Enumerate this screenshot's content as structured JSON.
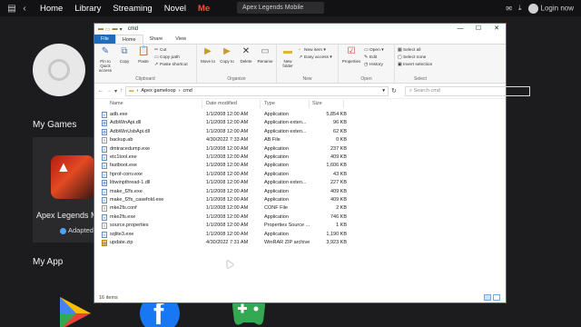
{
  "emulator": {
    "nav": [
      "Home",
      "Library",
      "Streaming",
      "Novel",
      "Me"
    ],
    "active_nav": "Me",
    "search_text": "Apex Legends Mobile",
    "login_label": "Login now",
    "accent": "#ff4b3e"
  },
  "page": {
    "my_games_title": "My Games",
    "game_name": "Apex Legends M",
    "game_badge": "Adapted",
    "my_app_title": "My App"
  },
  "explorer": {
    "title": "cmd",
    "controls": [
      "—",
      "☐",
      "✕"
    ],
    "tabs": [
      "File",
      "Home",
      "Share",
      "View"
    ],
    "ribbon": {
      "clipboard": {
        "pin": "Pin to Quick access",
        "copy": "Copy",
        "paste": "Paste",
        "cut": "Cut",
        "copy_path": "Copy path",
        "paste_shortcut": "Paste shortcut",
        "label": "Clipboard"
      },
      "organize": {
        "move_to": "Move to",
        "copy_to": "Copy to",
        "delete": "Delete",
        "rename": "Rename",
        "label": "Organize"
      },
      "new": {
        "new_folder": "New folder",
        "new_item": "New item",
        "easy_access": "Easy access",
        "label": "New"
      },
      "open": {
        "properties": "Properties",
        "open": "Open",
        "edit": "Edit",
        "history": "History",
        "label": "Open"
      },
      "select": {
        "select_all": "Select all",
        "select_none": "Select none",
        "invert": "Invert selection",
        "label": "Select"
      }
    },
    "breadcrumb": [
      "Apex gameloop",
      "cmd"
    ],
    "search_placeholder": "Search cmd",
    "columns": [
      "Name",
      "Date modified",
      "Type",
      "Size"
    ],
    "files": [
      {
        "name": "adb.exe",
        "date": "1/1/2008 12:00 AM",
        "type": "Application",
        "size": "5,854 KB",
        "icon": "exe"
      },
      {
        "name": "AdbWinApi.dll",
        "date": "1/1/2008 12:00 AM",
        "type": "Application exten...",
        "size": "96 KB",
        "icon": "dll"
      },
      {
        "name": "AdbWinUsbApi.dll",
        "date": "1/1/2008 12:00 AM",
        "type": "Application exten...",
        "size": "62 KB",
        "icon": "dll"
      },
      {
        "name": "backup.ab",
        "date": "4/30/2022 7:33 AM",
        "type": "AB File",
        "size": "0 KB",
        "icon": "text"
      },
      {
        "name": "dmtracedump.exe",
        "date": "1/1/2008 12:00 AM",
        "type": "Application",
        "size": "237 KB",
        "icon": "exe"
      },
      {
        "name": "etc1tool.exe",
        "date": "1/1/2008 12:00 AM",
        "type": "Application",
        "size": "409 KB",
        "icon": "exe"
      },
      {
        "name": "fastboot.exe",
        "date": "1/1/2008 12:00 AM",
        "type": "Application",
        "size": "1,606 KB",
        "icon": "exe"
      },
      {
        "name": "hprof-conv.exe",
        "date": "1/1/2008 12:00 AM",
        "type": "Application",
        "size": "43 KB",
        "icon": "exe"
      },
      {
        "name": "libwinpthread-1.dll",
        "date": "1/1/2008 12:00 AM",
        "type": "Application exten...",
        "size": "227 KB",
        "icon": "dll"
      },
      {
        "name": "make_f2fs.exe",
        "date": "1/1/2008 12:00 AM",
        "type": "Application",
        "size": "409 KB",
        "icon": "exe"
      },
      {
        "name": "make_f2fs_casefold.exe",
        "date": "1/1/2008 12:00 AM",
        "type": "Application",
        "size": "409 KB",
        "icon": "exe"
      },
      {
        "name": "mke2fs.conf",
        "date": "1/1/2008 12:00 AM",
        "type": "CONF File",
        "size": "2 KB",
        "icon": "text"
      },
      {
        "name": "mke2fs.exe",
        "date": "1/1/2008 12:00 AM",
        "type": "Application",
        "size": "746 KB",
        "icon": "exe"
      },
      {
        "name": "source.properties",
        "date": "1/1/2008 12:00 AM",
        "type": "Properties Source ...",
        "size": "1 KB",
        "icon": "text"
      },
      {
        "name": "sqlite3.exe",
        "date": "1/1/2008 12:00 AM",
        "type": "Application",
        "size": "1,190 KB",
        "icon": "exe"
      },
      {
        "name": "update.zip",
        "date": "4/30/2022 7:31 AM",
        "type": "WinRAR ZIP archive",
        "size": "3,923 KB",
        "icon": "zip"
      }
    ],
    "status": "16 items"
  }
}
